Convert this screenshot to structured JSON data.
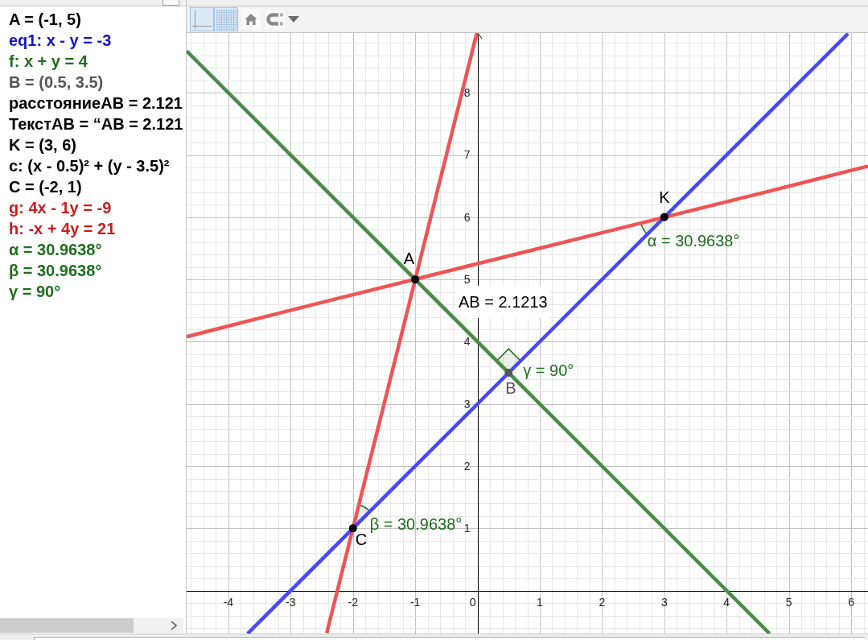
{
  "algebra_view": {
    "items": [
      {
        "text": "A = (-1, 5)",
        "color": "#000000"
      },
      {
        "text": "eq1: x - y = -3",
        "color": "#1414c8"
      },
      {
        "text": "f: x + y = 4",
        "color": "#1e6e1e"
      },
      {
        "text": "B = (0.5, 3.5)",
        "color": "#555555"
      },
      {
        "text": "расстояниеAB = 2.121",
        "color": "#000000"
      },
      {
        "text": "ТекстAB = “AB = 2.121",
        "color": "#000000"
      },
      {
        "text": "K = (3, 6)",
        "color": "#000000"
      },
      {
        "text": "c: (x - 0.5)² + (y - 3.5)²",
        "color": "#000000"
      },
      {
        "text": "C = (-2, 1)",
        "color": "#000000"
      },
      {
        "text": "g: 4x - 1y = -9",
        "color": "#c81e1e"
      },
      {
        "text": "h: -x + 4y = 21",
        "color": "#c81e1e"
      },
      {
        "text": "α = 30.9638°",
        "color": "#1e6e1e"
      },
      {
        "text": "β = 30.9638°",
        "color": "#1e6e1e"
      },
      {
        "text": "γ = 90°",
        "color": "#1e6e1e"
      }
    ]
  },
  "graphics_view": {
    "toolbar": [
      {
        "kind": "axes",
        "on": true
      },
      {
        "kind": "grid",
        "on": true
      },
      {
        "kind": "home"
      },
      {
        "kind": "point_capture"
      }
    ],
    "chart_data": {
      "type": "line",
      "grid": true,
      "x": [
        -4.67,
        -3.69,
        -2.42,
        -0.01,
        4.69,
        5.95,
        6.27
      ],
      "xlim": [
        -4.67,
        6.27
      ],
      "ylim": [
        -0.69,
        8.96
      ],
      "xticks": [
        -4,
        -3,
        -2,
        -1,
        0,
        1,
        2,
        3,
        4,
        5,
        6
      ],
      "yticks": [
        1,
        2,
        3,
        4,
        5,
        6,
        7,
        8
      ],
      "series": [
        {
          "color": "#f05454",
          "values": [
            4.08,
            4.33,
            4.65,
            5.25,
            6.42,
            6.74,
            6.82
          ]
        },
        {
          "color": "#f05454",
          "values": [
            null,
            null,
            -0.68,
            8.96,
            null,
            null,
            null
          ]
        },
        {
          "color": "#4848f4",
          "values": [
            null,
            -0.69,
            0.58,
            2.99,
            7.69,
            8.95,
            null
          ]
        },
        {
          "color": "#4a8a4a",
          "values": [
            8.67,
            7.69,
            6.42,
            4.01,
            -0.69,
            null,
            null
          ]
        }
      ],
      "annotations": [
        {
          "text": "A",
          "x": -1,
          "y": 5
        },
        {
          "text": "B",
          "x": 0.5,
          "y": 3.5
        },
        {
          "text": "K",
          "x": 3,
          "y": 6
        },
        {
          "text": "C",
          "x": -2,
          "y": 1
        },
        {
          "text": "α = 30.9638°",
          "x": 3,
          "y": 6
        },
        {
          "text": "β = 30.9638°",
          "x": -2,
          "y": 1
        },
        {
          "text": "γ = 90°",
          "x": 0.5,
          "y": 3.5
        },
        "AB = 2.1213"
      ]
    }
  }
}
